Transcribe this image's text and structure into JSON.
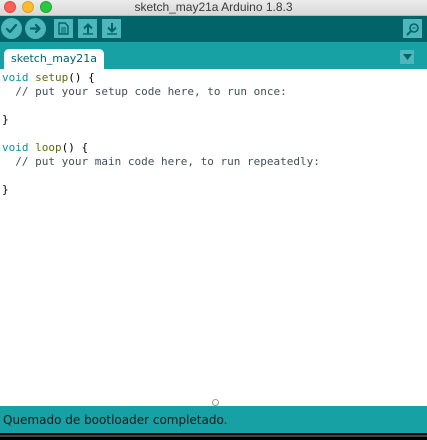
{
  "window": {
    "title": "sketch_may21a Arduino 1.8.3"
  },
  "toolbar": {
    "buttons": [
      {
        "name": "verify",
        "icon": "checkmark-icon"
      },
      {
        "name": "upload",
        "icon": "arrow-right-icon"
      },
      {
        "name": "new",
        "icon": "document-icon"
      },
      {
        "name": "open",
        "icon": "arrow-up-icon"
      },
      {
        "name": "save",
        "icon": "arrow-down-icon"
      },
      {
        "name": "serial-monitor",
        "icon": "magnifier-icon"
      }
    ]
  },
  "tabs": {
    "active_label": "sketch_may21a",
    "menu_icon": "triangle-down-icon"
  },
  "editor": {
    "line1": {
      "kw": "void",
      "fn": "setup",
      "rest": "() {"
    },
    "line2": "  // put your setup code here, to run once:",
    "line3": "",
    "line4": "}",
    "line5": "",
    "line6": {
      "kw": "void",
      "fn": "loop",
      "rest": "() {"
    },
    "line7": "  // put your main code here, to run repeatedly:",
    "line8": "",
    "line9": "}"
  },
  "status": {
    "message": "Quemado de bootloader completado."
  },
  "colors": {
    "toolbar_bg": "#006468",
    "tabbar_bg": "#17a1a5",
    "button_bg": "#4db7bb",
    "keyword": "#00979c",
    "function": "#5e6d03",
    "comment": "#434f54"
  }
}
